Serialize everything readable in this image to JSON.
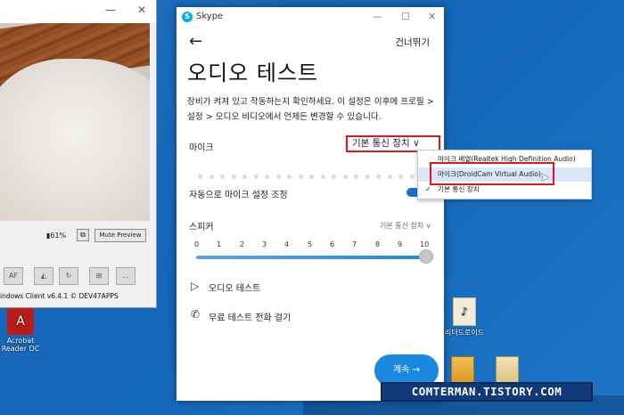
{
  "background_window": {
    "battery": "61%",
    "mute_label": "Mute Preview",
    "tool_af": "AF",
    "tool_more": "...",
    "footer": "indows Client v6.4.1 © DEV47APPS",
    "controls": {
      "minimize": "—",
      "close": "✕"
    }
  },
  "desktop": {
    "icon_acrobat": "Acrobat Reader DC",
    "icon_rdi": "리더드로이드"
  },
  "skype": {
    "title": "Skype",
    "controls": {
      "minimize": "—",
      "maximize": "☐",
      "close": "✕"
    },
    "back": "←",
    "skip": "건너뛰기",
    "heading": "오디오 테스트",
    "description": "장비가 켜져 있고 작동하는지 확인하세요. 이 설정은 이후에 프로필 > 설정 > 오디오 비디오에서 언제든 변경할 수 있습니다.",
    "mic_label": "마이크",
    "mic_selected": "기본 통신 장치 ∨",
    "auto_adjust_label": "자동으로 마이크 설정 조정",
    "speaker_label": "스피커",
    "speaker_selected": "기본 통신 장치 ∨",
    "scale": [
      "0",
      "1",
      "2",
      "3",
      "4",
      "5",
      "6",
      "7",
      "8",
      "9",
      "10"
    ],
    "play_icon": "▷",
    "audio_test": "오디오 테스트",
    "phone_icon": "✆",
    "free_call": "무료 테스트 전화 걸기",
    "continue": "계속 →"
  },
  "dropdown": {
    "options": [
      "마이크 배열(Realtek High Definition Audio)",
      "마이크(DroidCam Virtual Audio)",
      "기본 통신 장치"
    ],
    "check": "✓"
  },
  "watermark": "COMTERMAN.TISTORY.COM"
}
